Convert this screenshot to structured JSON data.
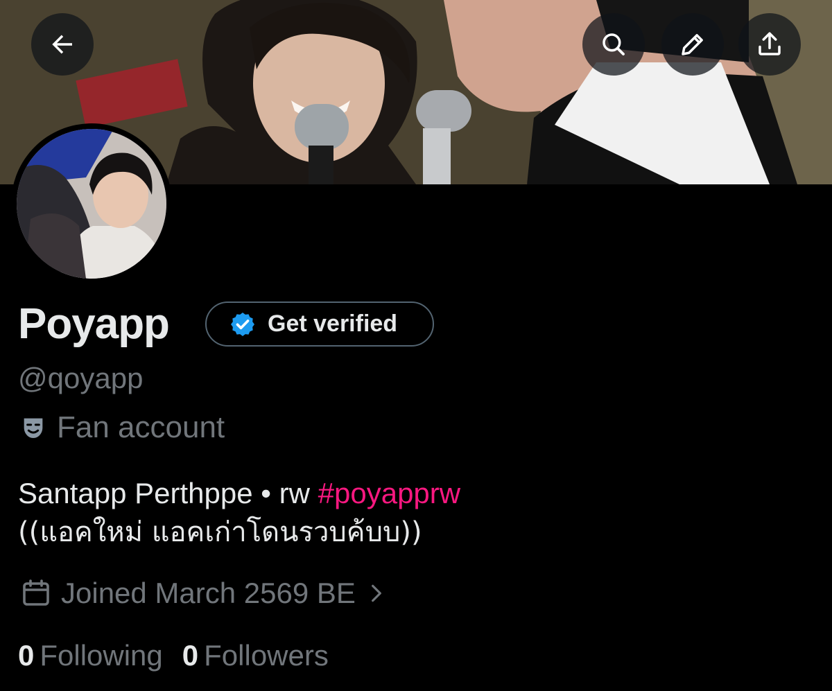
{
  "header": {
    "back_icon": "arrow-left-icon",
    "search_icon": "search-icon",
    "edit_icon": "pencil-icon",
    "share_icon": "share-upload-icon"
  },
  "profile": {
    "display_name": "Poyapp",
    "verify_button_label": "Get verified",
    "handle": "@qoyapp",
    "category": "Fan account",
    "bio": {
      "line1_text": "Santapp Perthppe • rw ",
      "hashtag": "#poyapprw",
      "line2": "((แอคใหม่ แอคเก่าโดนรวบค้บบ))"
    },
    "joined": "Joined March 2569 BE",
    "following_count": "0",
    "following_label": "Following",
    "followers_count": "0",
    "followers_label": "Followers"
  },
  "colors": {
    "background": "#000000",
    "text_primary": "#e7e9ea",
    "text_secondary": "#71767b",
    "hashtag": "#f91880",
    "verified_badge": "#1d9bf0",
    "pill_border": "#536471"
  }
}
